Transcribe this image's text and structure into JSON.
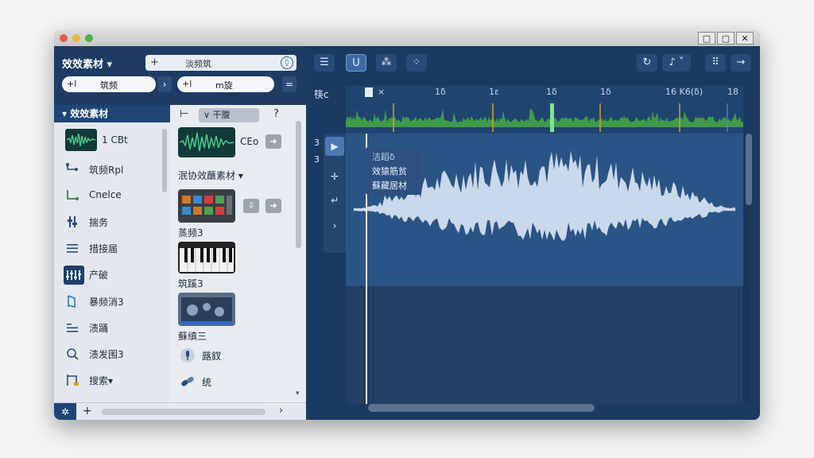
{
  "window": {
    "controls": [
      "□",
      "▢",
      "✕"
    ]
  },
  "left": {
    "title": "效效素材 ▾",
    "search_plus": "+",
    "search_text": "淡频筑",
    "pill1": {
      "a": "+l",
      "b": "筑频"
    },
    "pill2": {
      "a": "+l",
      "b": "m旋"
    },
    "tree_header": "▾ 效效素材",
    "tree_items": [
      {
        "label": "1 CBt",
        "icon": "waveform-icon"
      },
      {
        "label": "筑频Rpl",
        "icon": "routing-icon"
      },
      {
        "label": "Cnelce",
        "icon": "connector-icon"
      },
      {
        "label": "揣务",
        "icon": "fader-icon"
      },
      {
        "label": "措接届",
        "icon": "list-icon"
      },
      {
        "label": "产破",
        "icon": "mixer-icon"
      },
      {
        "label": "暴频消3",
        "icon": "door-icon"
      },
      {
        "label": "渍踊",
        "icon": "align-icon"
      },
      {
        "label": "渍发围3",
        "icon": "magnifier-icon"
      },
      {
        "label": "搜索▾",
        "icon": "bracket-icon"
      }
    ],
    "browser": {
      "toolbar_mark": "⊢",
      "toolbar_sort": "∨ 干腹",
      "toolbar_help": "?",
      "item1_label": "CEo",
      "section_title": "泯协效蘸素材 ▾",
      "item2_label": "蒸频3",
      "item3_label": "筑蹊3",
      "item4_label": "蘇缜三",
      "item5_label": "蕗釵",
      "item6_label": "统"
    }
  },
  "right": {
    "track_label": "筷c",
    "ruler_ticks": [
      "×",
      "1δ",
      "1ε",
      "1δ",
      "1δ",
      "16 K6(δ)",
      "18"
    ],
    "popup": {
      "title": "洁蹈δ",
      "line1": "效猿筋贫",
      "line2": "蘇藏居材"
    },
    "side_labels": [
      "3",
      "3"
    ]
  },
  "colors": {
    "window_bg": "#1c3557",
    "accent": "#3b6aa6",
    "waveform": "#c9d8ea",
    "overview_wave": "#3f9a4a",
    "marker": "#d9a21a"
  }
}
